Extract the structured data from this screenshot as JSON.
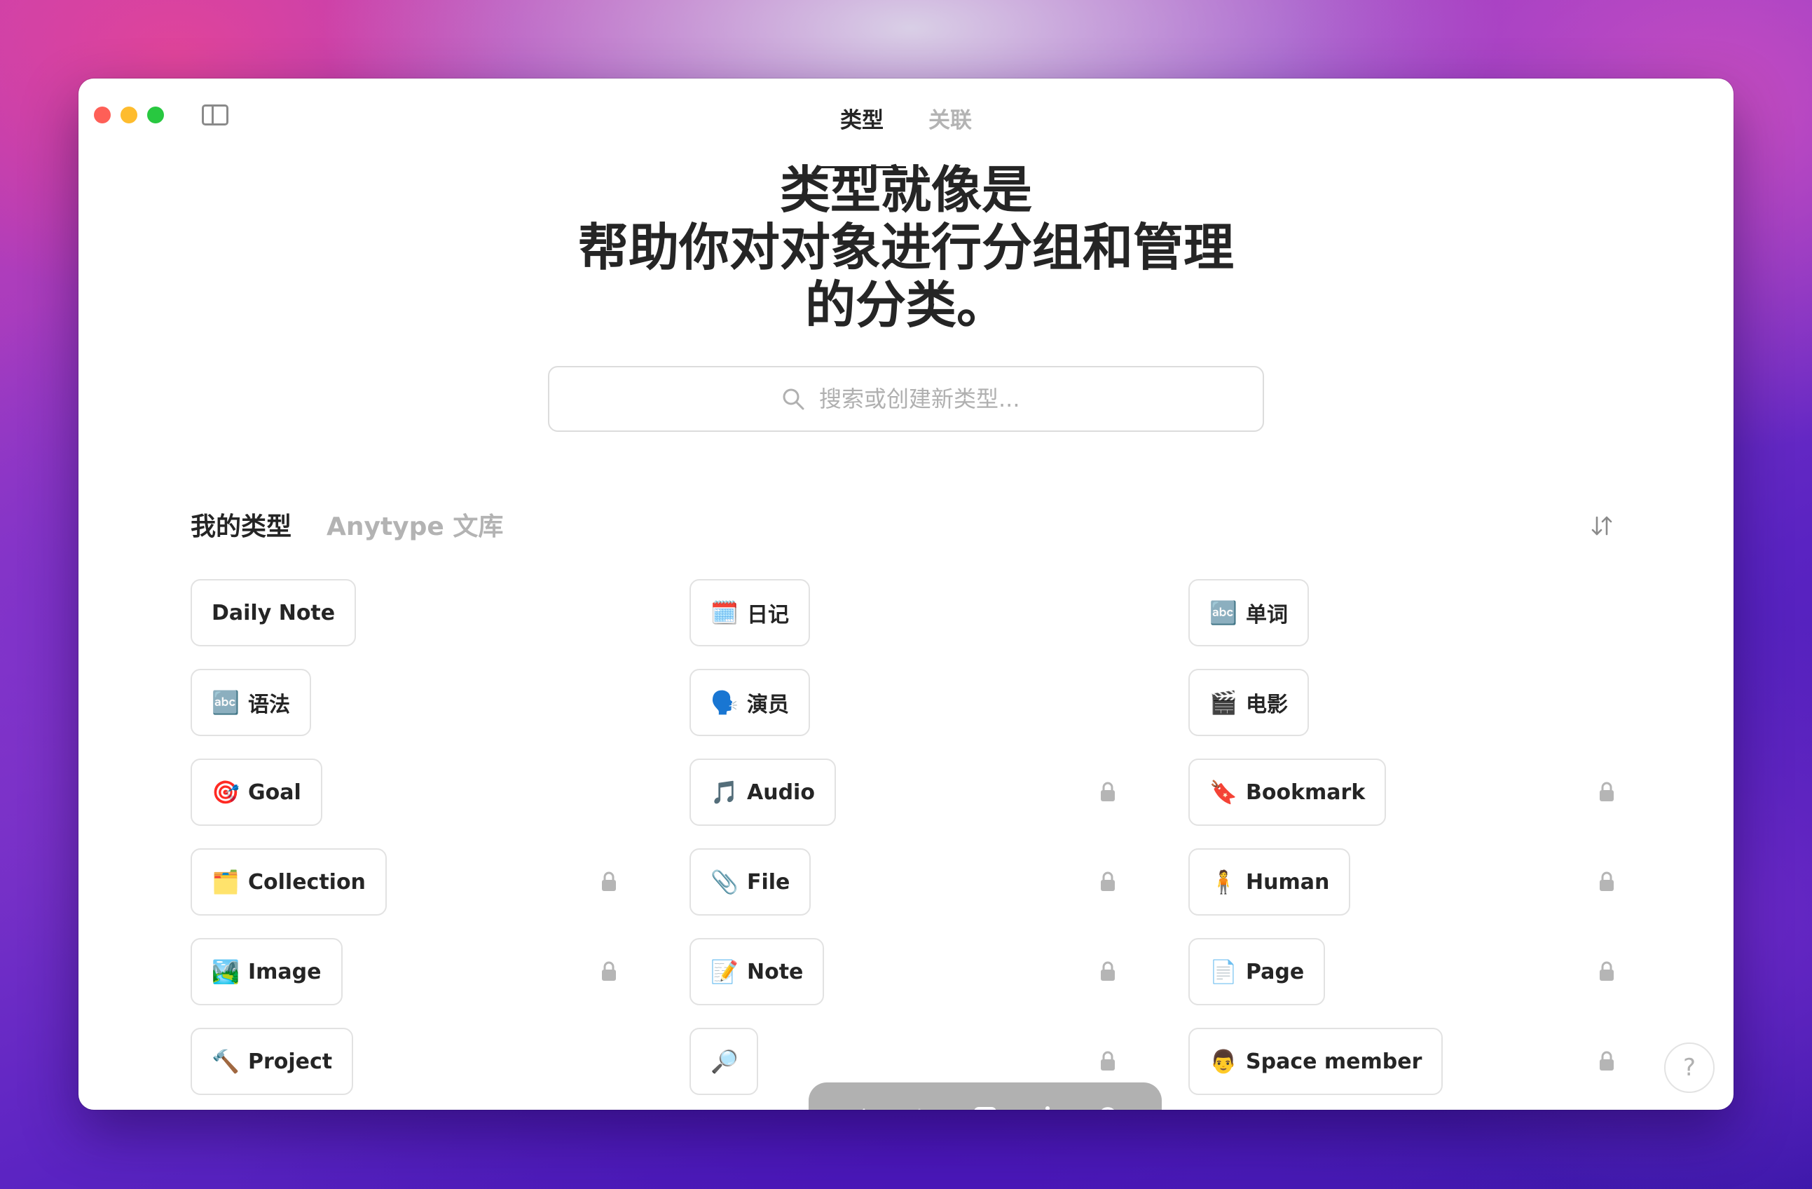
{
  "window": {
    "tabs": [
      {
        "label": "类型",
        "active": true
      },
      {
        "label": "关联",
        "active": false
      }
    ]
  },
  "hero": {
    "line1": "类型就像是",
    "line2": "帮助你对对象进行分组和管理",
    "line3": "的分类。"
  },
  "search": {
    "placeholder": "搜索或创建新类型..."
  },
  "section_tabs": [
    {
      "label": "我的类型",
      "active": true
    },
    {
      "label": "Anytype 文库",
      "active": false
    }
  ],
  "types": [
    {
      "label": "Daily Note",
      "emoji": "",
      "locked": false
    },
    {
      "label": "日记",
      "emoji": "🗓️",
      "locked": false
    },
    {
      "label": "单词",
      "emoji": "🔤",
      "locked": false
    },
    {
      "label": "语法",
      "emoji": "🔤",
      "locked": false
    },
    {
      "label": "演员",
      "emoji": "🗣️",
      "locked": false
    },
    {
      "label": "电影",
      "emoji": "🎬",
      "locked": false
    },
    {
      "label": "Goal",
      "emoji": "🎯",
      "locked": false
    },
    {
      "label": "Audio",
      "emoji": "🎵",
      "locked": true
    },
    {
      "label": "Bookmark",
      "emoji": "🔖",
      "locked": true
    },
    {
      "label": "Collection",
      "emoji": "🗂️",
      "locked": true
    },
    {
      "label": "File",
      "emoji": "📎",
      "locked": true
    },
    {
      "label": "Human",
      "emoji": "🧍",
      "locked": true
    },
    {
      "label": "Image",
      "emoji": "🏞️",
      "locked": true
    },
    {
      "label": "Note",
      "emoji": "📝",
      "locked": true
    },
    {
      "label": "Page",
      "emoji": "📄",
      "locked": true
    },
    {
      "label": "Project",
      "emoji": "🔨",
      "locked": false
    },
    {
      "label": "",
      "emoji": "🔎",
      "locked": true
    },
    {
      "label": "Space member",
      "emoji": "👨",
      "locked": true
    }
  ],
  "icons": {
    "search": "search-icon",
    "sort": "sort-arrows-icon",
    "lock": "lock-icon",
    "back": "chevron-left-icon",
    "forward": "chevron-right-icon",
    "add": "plus-square-icon",
    "graph": "graph-icon",
    "toolbar_search": "search-icon",
    "sidebar": "sidebar-toggle-icon"
  },
  "help": {
    "label": "?"
  },
  "colors": {
    "text": "#252525",
    "muted": "#b3b3b3",
    "chip_border": "#e2e2e2",
    "toolbar": "#a0a0a0"
  }
}
